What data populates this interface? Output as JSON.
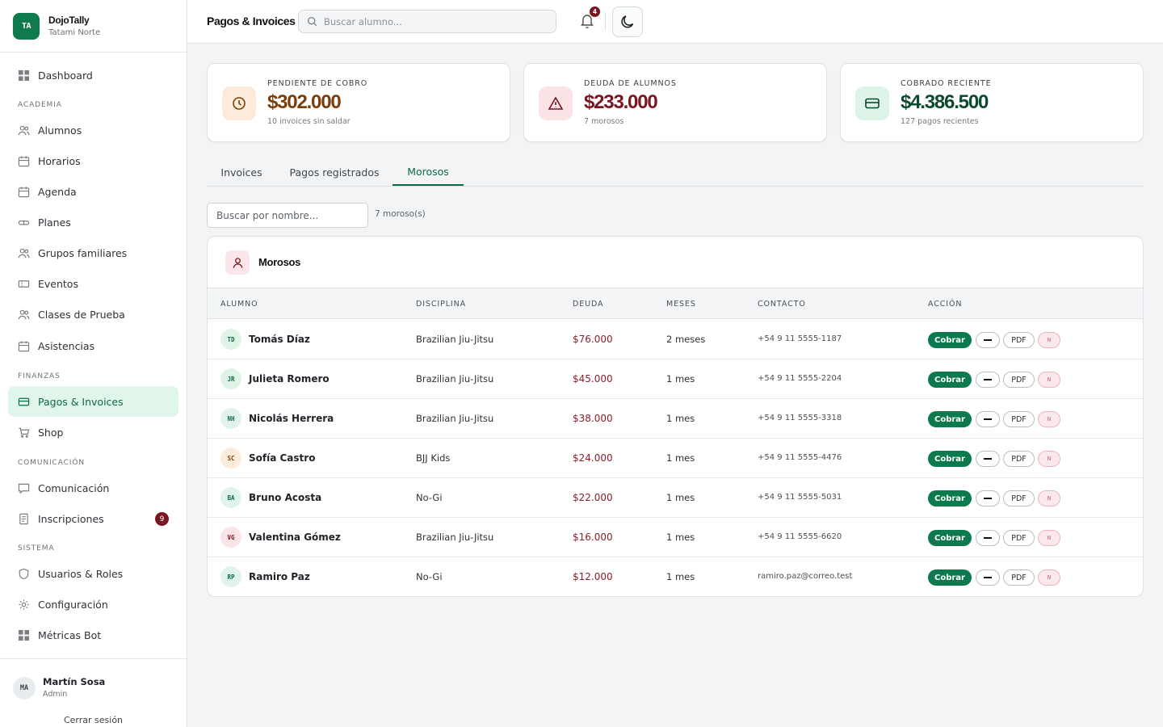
{
  "brand": {
    "logo": "TA",
    "name": "DojoTally",
    "subtitle": "Tatami Norte"
  },
  "sidebar": {
    "dashboard": "Dashboard",
    "sections": {
      "academia": "ACADEMIA",
      "finanzas": "FINANZAS",
      "comunicacion": "COMUNICACIÓN",
      "sistema": "SISTEMA"
    },
    "items": {
      "alumnos": "Alumnos",
      "horarios": "Horarios",
      "agenda": "Agenda",
      "planes": "Planes",
      "grupos": "Grupos familiares",
      "eventos": "Eventos",
      "clases": "Clases de Prueba",
      "asistencias": "Asistencias",
      "pagos": "Pagos & Invoices",
      "shop": "Shop",
      "comunicacion": "Comunicación",
      "inscripciones": "Inscripciones",
      "usuarios": "Usuarios & Roles",
      "config": "Configuración",
      "metricas": "Métricas Bot"
    },
    "inscripciones_badge": "9",
    "active_color": "#0c6b43"
  },
  "user": {
    "initials": "MA",
    "name": "Martín Sosa",
    "role": "Admin",
    "logout": "Cerrar sesión"
  },
  "header": {
    "title": "Pagos & Invoices",
    "search_placeholder": "Buscar alumno...",
    "notifications": "4"
  },
  "stats": [
    {
      "label": "PENDIENTE DE COBRO",
      "value": "$302.000",
      "sub": "10 invoices sin saldar",
      "color": "#7a3e0c"
    },
    {
      "label": "DEUDA DE ALUMNOS",
      "value": "$233.000",
      "sub": "7 morosos",
      "color": "#7a1522"
    },
    {
      "label": "COBRADO RECIENTE",
      "value": "$4.386.500",
      "sub": "127 pagos recientes",
      "color": "#0b4a2e"
    }
  ],
  "tabs": {
    "invoices": "Invoices",
    "pagos": "Pagos registrados",
    "morosos": "Morosos"
  },
  "filter": {
    "placeholder": "Buscar por nombre...",
    "count": "7 moroso(s)"
  },
  "table": {
    "title": "Morosos",
    "headers": {
      "alumno": "ALUMNO",
      "disciplina": "DISCIPLINA",
      "deuda": "DEUDA",
      "meses": "MESES",
      "contacto": "CONTACTO",
      "accion": "ACCIÓN"
    },
    "actions": {
      "cobrar": "Cobrar",
      "pdf": "PDF",
      "cancel": "N"
    },
    "rows": [
      {
        "initials": "TD",
        "name": "Tomás Díaz",
        "disciplina": "Brazilian Jiu-Jitsu",
        "deuda": "$76.000",
        "meses": "2 meses",
        "contacto": "+54 9 11 5555-1187"
      },
      {
        "initials": "JR",
        "name": "Julieta Romero",
        "disciplina": "Brazilian Jiu-Jitsu",
        "deuda": "$45.000",
        "meses": "1 mes",
        "contacto": "+54 9 11 5555-2204"
      },
      {
        "initials": "NH",
        "name": "Nicolás Herrera",
        "disciplina": "Brazilian Jiu-Jitsu",
        "deuda": "$38.000",
        "meses": "1 mes",
        "contacto": "+54 9 11 5555-3318"
      },
      {
        "initials": "SC",
        "name": "Sofía Castro",
        "disciplina": "BJJ Kids",
        "deuda": "$24.000",
        "meses": "1 mes",
        "contacto": "+54 9 11 5555-4476"
      },
      {
        "initials": "BA",
        "name": "Bruno Acosta",
        "disciplina": "No-Gi",
        "deuda": "$22.000",
        "meses": "1 mes",
        "contacto": "+54 9 11 5555-5031"
      },
      {
        "initials": "VG",
        "name": "Valentina Gómez",
        "disciplina": "Brazilian Jiu-Jitsu",
        "deuda": "$16.000",
        "meses": "1 mes",
        "contacto": "+54 9 11 5555-6620"
      },
      {
        "initials": "RP",
        "name": "Ramiro Paz",
        "disciplina": "No-Gi",
        "deuda": "$12.000",
        "meses": "1 mes",
        "contacto": "ramiro.paz@correo.test"
      }
    ]
  }
}
